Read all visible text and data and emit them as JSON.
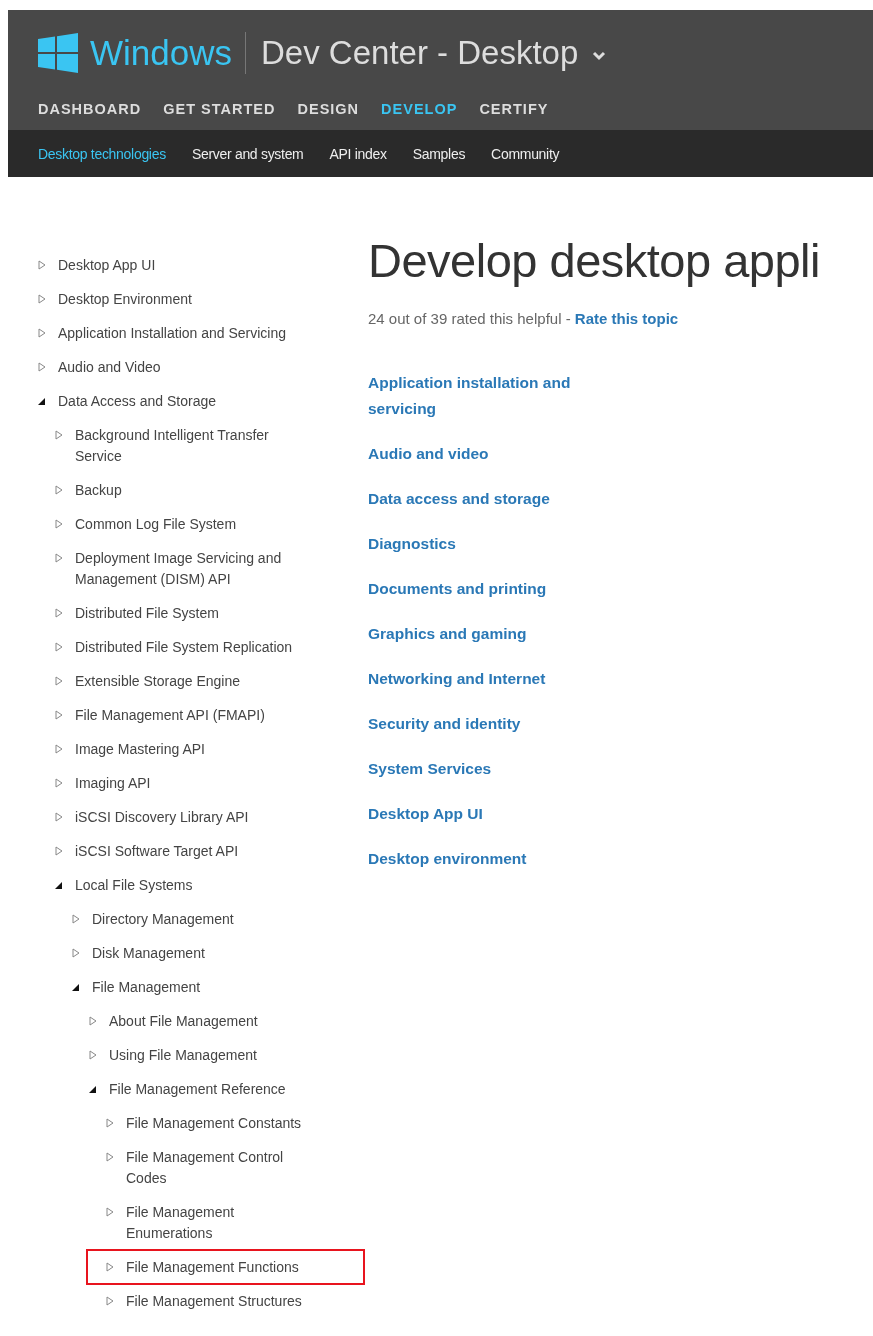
{
  "header": {
    "brand": "Windows",
    "site_title": "Dev Center - Desktop",
    "nav": [
      {
        "label": "DASHBOARD",
        "selected": false
      },
      {
        "label": "GET STARTED",
        "selected": false
      },
      {
        "label": "DESIGN",
        "selected": false
      },
      {
        "label": "DEVELOP",
        "selected": true
      },
      {
        "label": "CERTIFY",
        "selected": false
      }
    ],
    "subnav": [
      {
        "label": "Desktop technologies",
        "selected": true
      },
      {
        "label": "Server and system",
        "selected": false
      },
      {
        "label": "API index",
        "selected": false
      },
      {
        "label": "Samples",
        "selected": false
      },
      {
        "label": "Community",
        "selected": false
      }
    ]
  },
  "sidebar": {
    "items": [
      {
        "label": "Desktop App UI",
        "expanded": false,
        "highlighted": false
      },
      {
        "label": "Desktop Environment",
        "expanded": false,
        "highlighted": false
      },
      {
        "label": "Application Installation and Servicing",
        "expanded": false,
        "highlighted": false
      },
      {
        "label": "Audio and Video",
        "expanded": false,
        "highlighted": false
      },
      {
        "label": "Data Access and Storage",
        "expanded": true,
        "highlighted": false,
        "children": [
          {
            "label": "Background Intelligent Transfer Service",
            "expanded": false,
            "highlighted": false
          },
          {
            "label": "Backup",
            "expanded": false,
            "highlighted": false
          },
          {
            "label": "Common Log File System",
            "expanded": false,
            "highlighted": false
          },
          {
            "label": "Deployment Image Servicing and Management (DISM) API",
            "expanded": false,
            "highlighted": false
          },
          {
            "label": "Distributed File System",
            "expanded": false,
            "highlighted": false
          },
          {
            "label": "Distributed File System Replication",
            "expanded": false,
            "highlighted": false
          },
          {
            "label": "Extensible Storage Engine",
            "expanded": false,
            "highlighted": false
          },
          {
            "label": "File Management API (FMAPI)",
            "expanded": false,
            "highlighted": false
          },
          {
            "label": "Image Mastering API",
            "expanded": false,
            "highlighted": false
          },
          {
            "label": "Imaging API",
            "expanded": false,
            "highlighted": false
          },
          {
            "label": "iSCSI Discovery Library API",
            "expanded": false,
            "highlighted": false
          },
          {
            "label": "iSCSI Software Target API",
            "expanded": false,
            "highlighted": false
          },
          {
            "label": "Local File Systems",
            "expanded": true,
            "highlighted": false,
            "children": [
              {
                "label": "Directory Management",
                "expanded": false,
                "highlighted": false
              },
              {
                "label": "Disk Management",
                "expanded": false,
                "highlighted": false
              },
              {
                "label": "File Management",
                "expanded": true,
                "highlighted": false,
                "children": [
                  {
                    "label": "About File Management",
                    "expanded": false,
                    "highlighted": false
                  },
                  {
                    "label": "Using File Management",
                    "expanded": false,
                    "highlighted": false
                  },
                  {
                    "label": "File Management Reference",
                    "expanded": true,
                    "highlighted": false,
                    "children": [
                      {
                        "label": "File Management Constants",
                        "expanded": false,
                        "highlighted": false
                      },
                      {
                        "label": "File Management Control Codes",
                        "expanded": false,
                        "highlighted": false
                      },
                      {
                        "label": "File Management Enumerations",
                        "expanded": false,
                        "highlighted": false
                      },
                      {
                        "label": "File Management Functions",
                        "expanded": false,
                        "highlighted": true
                      },
                      {
                        "label": "File Management Structures",
                        "expanded": false,
                        "highlighted": false
                      }
                    ]
                  }
                ]
              }
            ]
          }
        ]
      }
    ]
  },
  "content": {
    "title": "Develop desktop appli",
    "rating": {
      "text": "24 out of 39 rated this helpful -",
      "link": "Rate this topic"
    },
    "links": [
      "Application installation and servicing",
      "Audio and video",
      "Data access and storage",
      "Diagnostics",
      "Documents and printing",
      "Graphics and gaming",
      "Networking and Internet",
      "Security and identity",
      "System Services",
      "Desktop App UI",
      "Desktop environment"
    ]
  }
}
